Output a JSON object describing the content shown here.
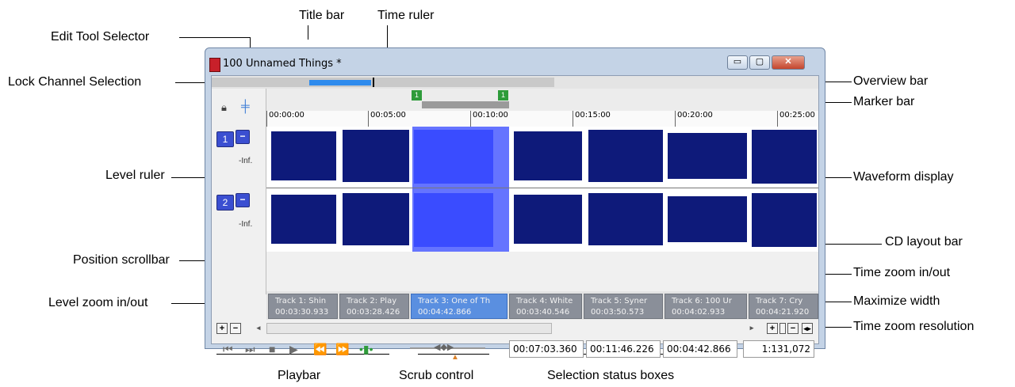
{
  "window": {
    "title": "100 Unnamed Things *",
    "minimize_glyph": "▭",
    "maximize_glyph": "▢",
    "close_glyph": "✕"
  },
  "callouts": {
    "title_bar": "Title bar",
    "time_ruler": "Time ruler",
    "edit_tool_selector": "Edit Tool Selector",
    "lock_channel_selection": "Lock Channel Selection",
    "overview_bar": "Overview bar",
    "marker_bar": "Marker bar",
    "level_ruler": "Level ruler",
    "waveform_display": "Waveform display",
    "cd_layout_bar": "CD layout bar",
    "position_scrollbar": "Position scrollbar",
    "time_zoom_in_out": "Time zoom in/out",
    "level_zoom_in_out": "Level zoom in/out",
    "maximize_width": "Maximize width",
    "time_zoom_resolution": "Time zoom resolution",
    "playbar": "Playbar",
    "scrub_control": "Scrub control",
    "selection_status_boxes": "Selection status boxes"
  },
  "channels": [
    {
      "number": "1",
      "level": "-Inf."
    },
    {
      "number": "2",
      "level": "-Inf."
    }
  ],
  "markers": [
    "1",
    "1"
  ],
  "time_ruler": [
    "00:00:00",
    "00:05:00",
    "00:10:00",
    "00:15:00",
    "00:20:00",
    "00:25:00"
  ],
  "cd_tracks": [
    {
      "name": "Track 1: Shin",
      "time": "00:03:30.933"
    },
    {
      "name": "Track 2: Play",
      "time": "00:03:28.426"
    },
    {
      "name": "Track 3: One of Th",
      "time": "00:04:42.866"
    },
    {
      "name": "Track 4: White",
      "time": "00:03:40.546"
    },
    {
      "name": "Track 5: Syner",
      "time": "00:03:50.573"
    },
    {
      "name": "Track 6: 100 Ur",
      "time": "00:04:02.933"
    },
    {
      "name": "Track 7: Cry",
      "time": "00:04:21.920"
    }
  ],
  "status": {
    "start": "00:07:03.360",
    "end": "00:11:46.226",
    "length": "00:04:42.866",
    "zoom_ratio": "1:131,072"
  },
  "icons": {
    "lock": "lock-icon",
    "edit_tool": "edit-tool-icon",
    "go_start": "go-to-start-icon",
    "go_end": "go-to-end-icon",
    "stop": "stop-icon",
    "play": "play-icon",
    "prev_track": "previous-track-icon",
    "next_track": "next-track-icon",
    "loop": "loop-icon"
  },
  "colors": {
    "selection": "#4a5cff",
    "waveform": "#0e1a7a",
    "marker": "#2e9b3a",
    "channel_button": "#3b4fd1",
    "overview_thumb": "#2e8bed"
  }
}
